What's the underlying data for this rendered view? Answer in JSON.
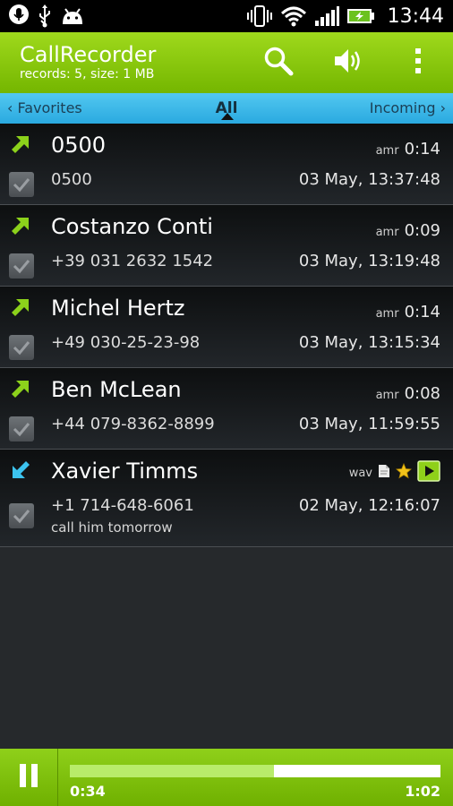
{
  "status_bar": {
    "time": "13:44",
    "icons": [
      "microphone-icon",
      "usb-icon",
      "android-icon",
      "vibrate-icon",
      "wifi-icon",
      "signal-icon",
      "battery-charging-icon"
    ]
  },
  "app_bar": {
    "title": "CallRecorder",
    "subtitle": "records: 5, size: 1 MB",
    "actions": [
      "search-icon",
      "speaker-icon",
      "overflow-menu-icon"
    ],
    "accent_color": "#8cc814"
  },
  "tabs": {
    "left": "‹ Favorites",
    "center": "All",
    "right": "Incoming ›",
    "color": "#3bb8e8"
  },
  "records": [
    {
      "name": "0500",
      "number": "0500",
      "format": "amr",
      "duration": "0:14",
      "date": "03 May, 13:37:48",
      "direction": "outgoing"
    },
    {
      "name": "Costanzo Conti",
      "number": "+39 031 2632 1542",
      "format": "amr",
      "duration": "0:09",
      "date": "03 May, 13:19:48",
      "direction": "outgoing"
    },
    {
      "name": "Michel Hertz",
      "number": "+49 030-25-23-98",
      "format": "amr",
      "duration": "0:14",
      "date": "03 May, 13:15:34",
      "direction": "outgoing"
    },
    {
      "name": "Ben McLean",
      "number": "+44 079-8362-8899",
      "format": "amr",
      "duration": "0:08",
      "date": "03 May, 11:59:55",
      "direction": "outgoing"
    },
    {
      "name": "Xavier Timms",
      "number": "+1 714-648-6061",
      "format": "wav",
      "duration": "",
      "date": "02 May, 12:16:07",
      "direction": "incoming",
      "note": "call him tomorrow",
      "icons": [
        "note-icon",
        "star-icon",
        "play-icon"
      ]
    }
  ],
  "player": {
    "current": "0:34",
    "total": "1:02",
    "progress_fraction": 0.55
  }
}
